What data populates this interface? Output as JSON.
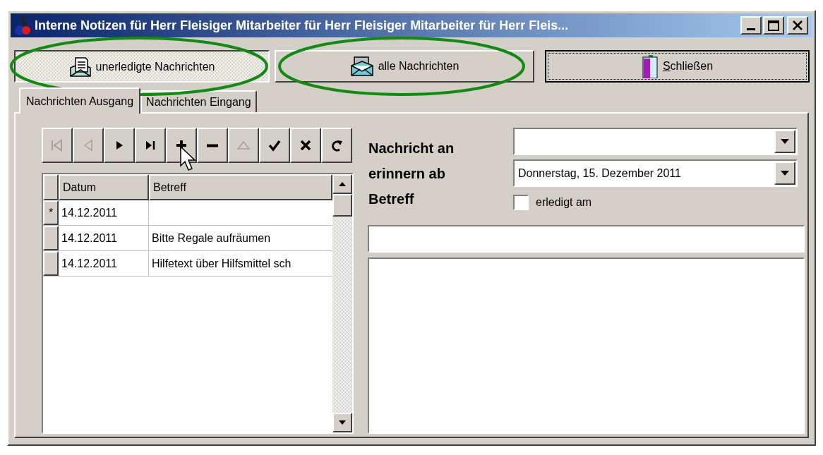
{
  "window": {
    "title": "Interne Notizen für Herr Fleisiger Mitarbeiter für Herr Fleisiger Mitarbeiter für Herr Fleis..."
  },
  "buttons": [
    {
      "kind": "unread",
      "label": "unerledigte Nachrichten",
      "selected": true,
      "highlighted": true,
      "focused": false
    },
    {
      "kind": "all",
      "label": "alle Nachrichten",
      "selected": false,
      "highlighted": true,
      "focused": false
    },
    {
      "kind": "close",
      "label": "Schließen",
      "selected": false,
      "highlighted": false,
      "focused": true
    }
  ],
  "tabs": [
    {
      "label": "Nachrichten Ausgang",
      "selected": true
    },
    {
      "label": "Nachrichten Eingang",
      "selected": false
    }
  ],
  "navigator": [
    {
      "kind": "first",
      "disabled": true
    },
    {
      "kind": "prior",
      "disabled": true
    },
    {
      "kind": "next",
      "disabled": false
    },
    {
      "kind": "last",
      "disabled": false
    },
    {
      "kind": "insert",
      "disabled": false
    },
    {
      "kind": "delete",
      "disabled": false
    },
    {
      "kind": "edit",
      "disabled": true
    },
    {
      "kind": "post",
      "disabled": false
    },
    {
      "kind": "cancel",
      "disabled": false
    },
    {
      "kind": "refresh",
      "disabled": false
    }
  ],
  "table": {
    "columns": [
      "Datum",
      "Betreff"
    ],
    "rows": [
      {
        "indicator": "*",
        "datum": "14.12.2011"
      },
      {
        "datum": "14.12.2011",
        "betreff": "Bitte Regale aufräumen"
      },
      {
        "datum": "14.12.2011",
        "betreff": "Hilfetext über Hilfsmittel sch"
      }
    ]
  },
  "form": {
    "labels": [
      "Nachricht an",
      "erinnern ab",
      "Betreff"
    ],
    "date_value": "Donnerstag, 15. Dezember 2011",
    "done_checkbox": {
      "label": "erledigt am",
      "checked": false
    }
  }
}
